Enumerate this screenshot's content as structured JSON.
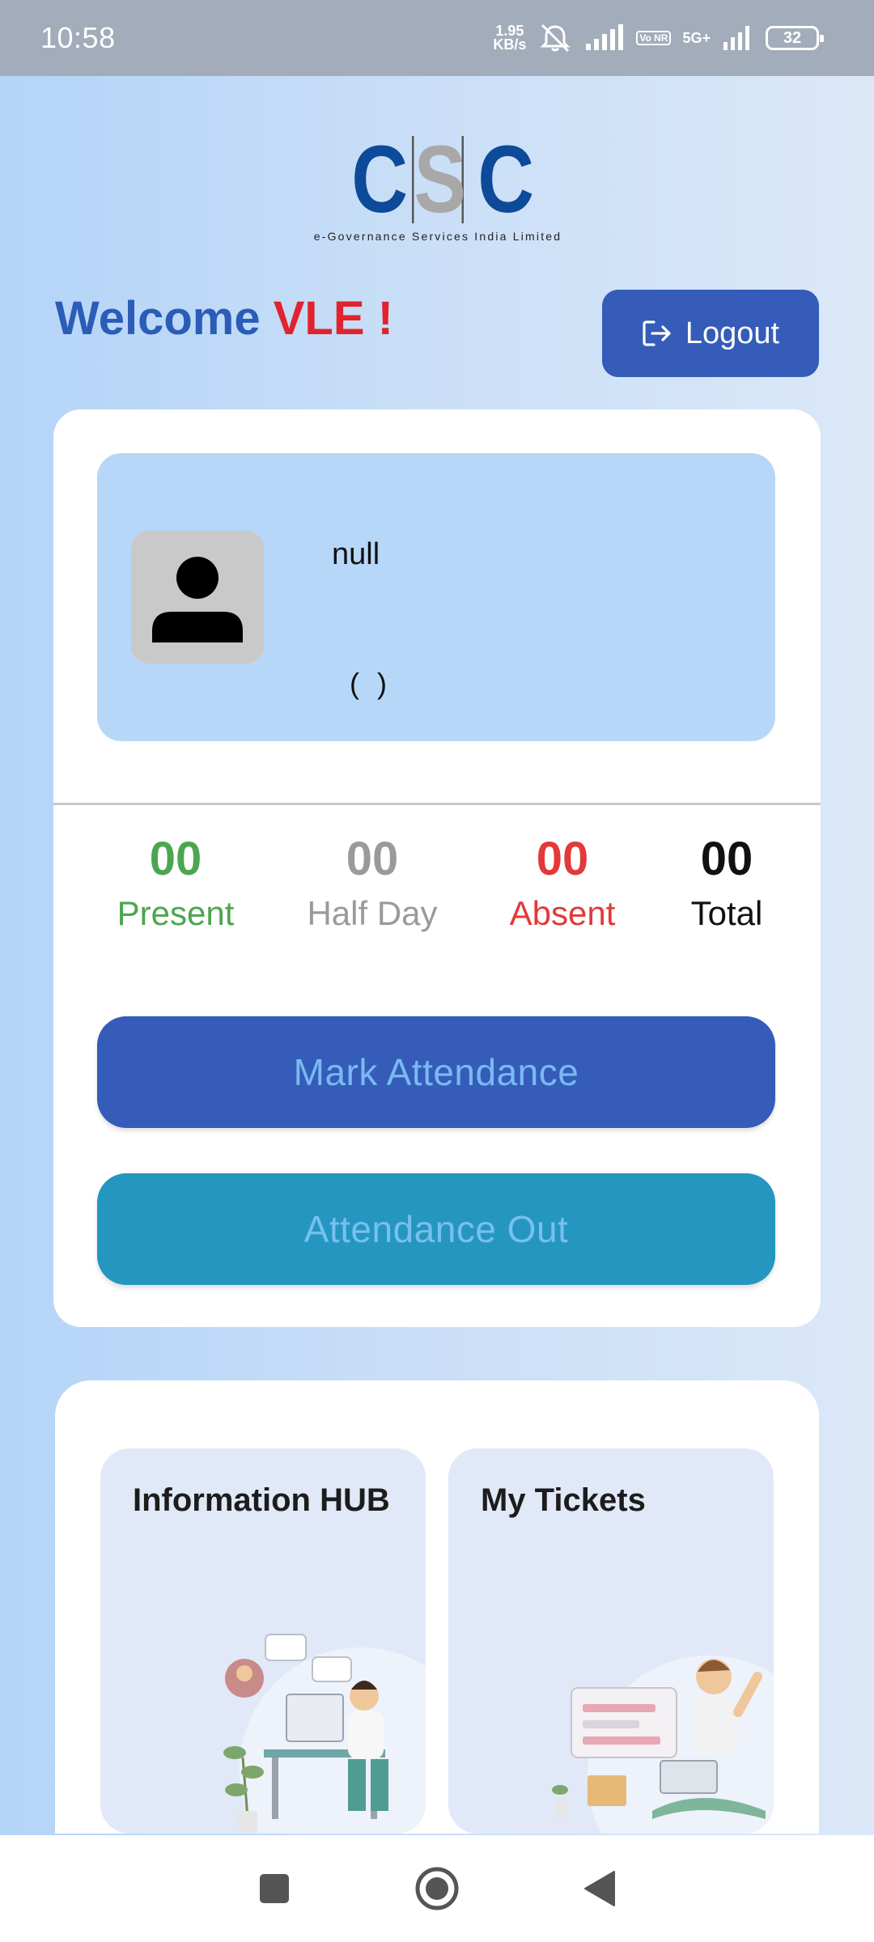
{
  "status_bar": {
    "time": "10:58",
    "net_speed_value": "1.95",
    "net_speed_unit": "KB/s",
    "volte": "Vo NR",
    "network": "5G+",
    "battery": "32"
  },
  "logo": {
    "letters": [
      "C",
      "S",
      "C"
    ],
    "tagline": "e-Governance Services India Limited"
  },
  "welcome": {
    "prefix": "Welcome",
    "name": "VLE !"
  },
  "logout_label": "Logout",
  "profile": {
    "name": "null",
    "subtitle": "( )"
  },
  "stats": [
    {
      "value": "00",
      "label": "Present",
      "color": "#4ca64f"
    },
    {
      "value": "00",
      "label": "Half Day",
      "color": "#9a9a9a"
    },
    {
      "value": "00",
      "label": "Absent",
      "color": "#e2393a"
    },
    {
      "value": "00",
      "label": "Total",
      "color": "#111111"
    }
  ],
  "buttons": {
    "mark_attendance": "Mark Attendance",
    "attendance_out": "Attendance Out"
  },
  "tiles": [
    {
      "title": "Information HUB",
      "icon": "support-agent-illustration"
    },
    {
      "title": "My Tickets",
      "icon": "tickets-illustration"
    }
  ],
  "nav": {
    "recents_icon": "square-icon",
    "home_icon": "circle-icon",
    "back_icon": "triangle-back-icon"
  },
  "colors": {
    "primary": "#345cb8",
    "teal": "#2596bf",
    "accent_red": "#e0232c"
  }
}
